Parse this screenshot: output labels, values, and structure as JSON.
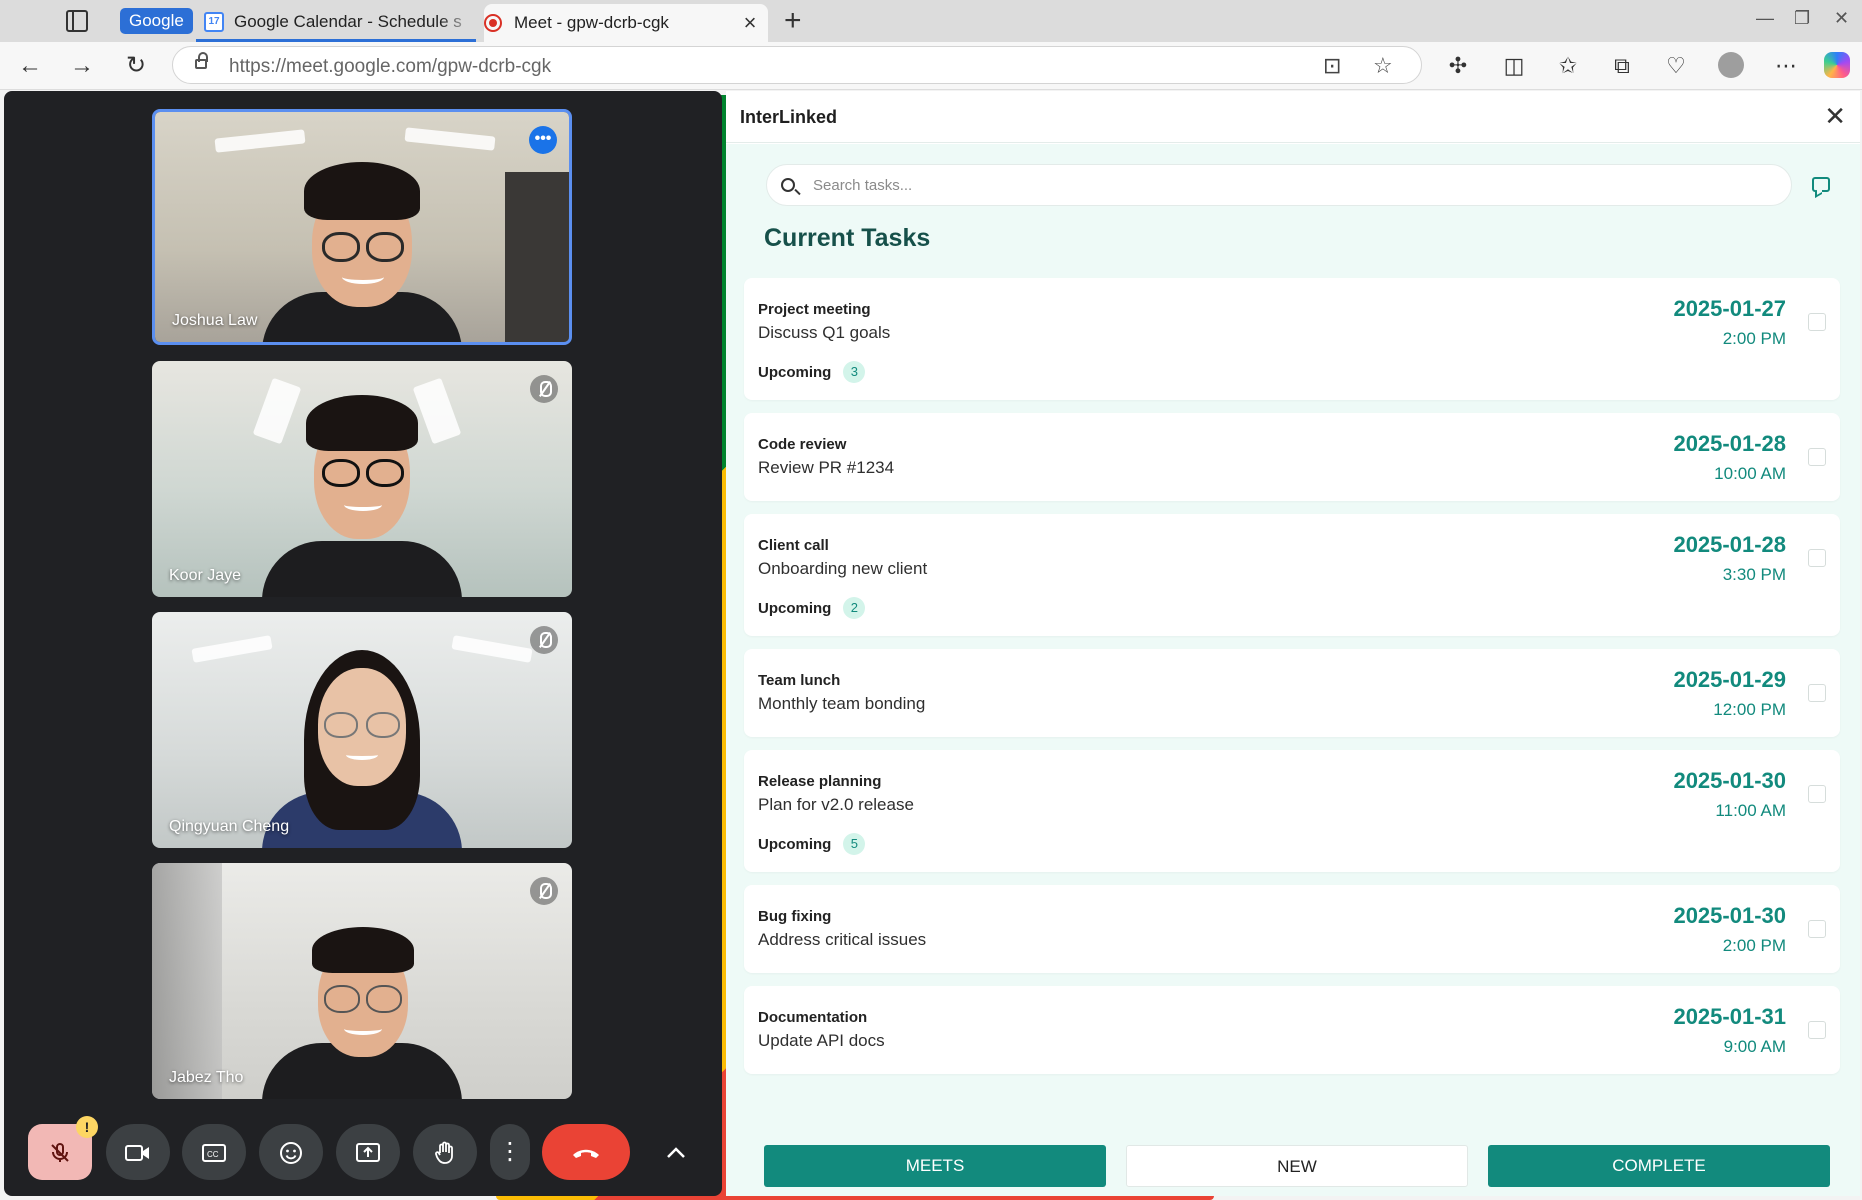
{
  "browser": {
    "tab_group_label": "Google",
    "tabs": [
      {
        "title": "Google Calendar - Schedule s",
        "favicon_label": "17"
      },
      {
        "title": "Meet - gpw-dcrb-cgk"
      }
    ],
    "address": {
      "host": "https://meet.google.com/",
      "path": "gpw-dcrb-cgk"
    }
  },
  "meet": {
    "participants": [
      {
        "name": "Joshua Law",
        "active": true
      },
      {
        "name": "Koor Jaye",
        "muted": true
      },
      {
        "name": "Qingyuan Cheng",
        "muted": true
      },
      {
        "name": "Jabez Tho",
        "muted": true
      }
    ],
    "warning_badge": "!"
  },
  "panel": {
    "title": "InterLinked",
    "search": {
      "placeholder": "Search tasks...",
      "value": ""
    },
    "section_title": "Current Tasks",
    "tasks": [
      {
        "title": "Project meeting",
        "description": "Discuss Q1 goals",
        "date": "2025-01-27",
        "time": "2:00 PM",
        "status": "Upcoming",
        "count": "3"
      },
      {
        "title": "Code review",
        "description": "Review PR #1234",
        "date": "2025-01-28",
        "time": "10:00 AM"
      },
      {
        "title": "Client call",
        "description": "Onboarding new client",
        "date": "2025-01-28",
        "time": "3:30 PM",
        "status": "Upcoming",
        "count": "2"
      },
      {
        "title": "Team lunch",
        "description": "Monthly team bonding",
        "date": "2025-01-29",
        "time": "12:00 PM"
      },
      {
        "title": "Release planning",
        "description": "Plan for v2.0 release",
        "date": "2025-01-30",
        "time": "11:00 AM",
        "status": "Upcoming",
        "count": "5"
      },
      {
        "title": "Bug fixing",
        "description": "Address critical issues",
        "date": "2025-01-30",
        "time": "2:00 PM"
      },
      {
        "title": "Documentation",
        "description": "Update API docs",
        "date": "2025-01-31",
        "time": "9:00 AM"
      }
    ],
    "actions": {
      "meets": "MEETS",
      "new": "NEW",
      "complete": "COMPLETE"
    },
    "colors": {
      "accent": "#128a7d",
      "background": "#eefaf7",
      "heading": "#16504a"
    }
  }
}
